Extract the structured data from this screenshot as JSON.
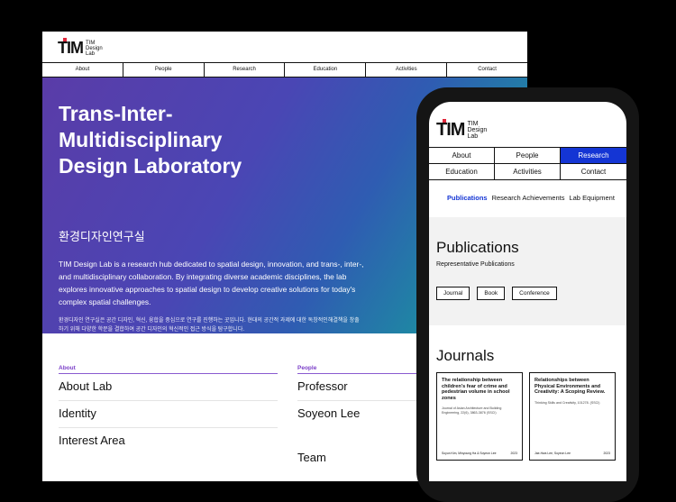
{
  "desktop": {
    "logo": {
      "mark": "TIM",
      "line1": "TIM",
      "line2": "Design",
      "line3": "Lab"
    },
    "nav": [
      "About",
      "People",
      "Research",
      "Education",
      "Activities",
      "Contact"
    ],
    "hero": {
      "title": "Trans-Inter-\nMultidisciplinary\nDesign Laboratory",
      "title_ko": "환경디자인연구실",
      "description": "TIM Design Lab is a research hub dedicated to spatial design, innovation, and trans-, inter-, and multidisciplinary collaboration. By integrating diverse academic disciplines, the lab explores innovative approaches to spatial design to develop creative solutions for today's complex spatial challenges.",
      "description_ko": "환경디자인 연구실은 공간 디자인, 혁신, 융합을 중심으로 연구를 진행하는 곳입니다. 현대의 공간적 과제에 대한 독창적인해결책을 창출하기 위해 다양한 학문을 결합하여 공간 디자인의 혁신적인 접근 방식을 탐구합니다."
    },
    "about": {
      "heading": "About",
      "items": [
        "About Lab",
        "Identity",
        "Interest Area"
      ]
    },
    "people": {
      "heading": "People",
      "items": [
        "Professor",
        "Soyeon Lee",
        "Team"
      ]
    }
  },
  "mobile": {
    "logo": {
      "mark": "TIM",
      "line1": "TIM",
      "line2": "Design",
      "line3": "Lab"
    },
    "nav": [
      "About",
      "People",
      "Research",
      "Education",
      "Activities",
      "Contact"
    ],
    "nav_active": "Research",
    "subnav": [
      "Publications",
      "Research Achievements",
      "Lab Equipment"
    ],
    "subnav_active": "Publications",
    "publications": {
      "title": "Publications",
      "subtitle": "Representative Publications",
      "filters": [
        "Journal",
        "Book",
        "Conference"
      ]
    },
    "journals": {
      "title": "Journals",
      "cards": [
        {
          "title": "The relationship between children's fear of crime and pedestrian volume in school zones",
          "journal": "Journal of Asian Architecture and Building Engineering, 22(6), 3863-3876 (SSCI)",
          "authors": "Soyun Kim, Minyoung Ha & Soyeon Lee",
          "year": "2023"
        },
        {
          "title": "Relationships between Physical Environments and Creativity: A Scoping Review.",
          "journal": "Thinking Skills and Creativity, 101278. (SSCI)",
          "authors": "Jae-Hwa Lee, Soyeon Lee",
          "year": "2023"
        }
      ]
    }
  },
  "colors": {
    "accent_blue": "#1435d4",
    "accent_purple": "#7b3fc8",
    "logo_red": "#e0283c"
  }
}
